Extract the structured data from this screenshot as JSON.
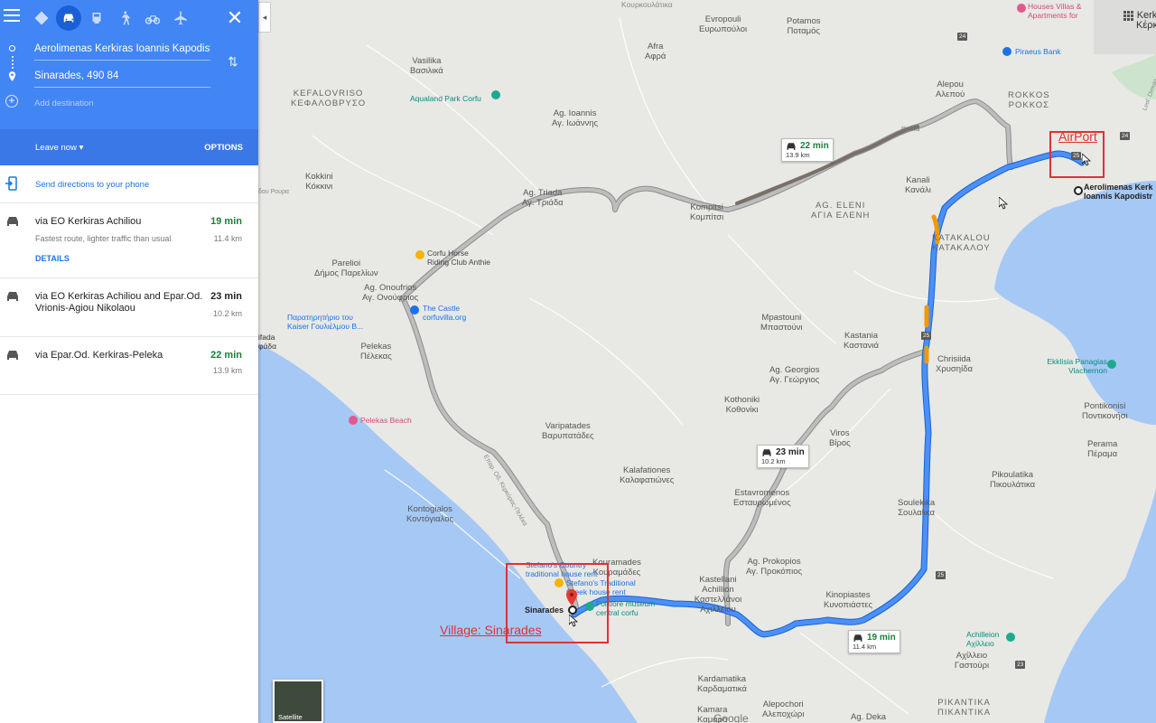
{
  "panel": {
    "travel_modes": [
      "best-mode",
      "driving",
      "transit",
      "walking",
      "cycling",
      "flights"
    ],
    "origin": "Aerolimenas Kerkiras Ioannis Kapodistr",
    "destination": "Sinarades, 490 84",
    "add_destination": "Add destination",
    "leave_now": "Leave now",
    "options": "OPTIONS",
    "send_directions": "Send directions to your phone",
    "routes": [
      {
        "name": "via EO Kerkiras Achiliou",
        "time": "19 min",
        "distance": "11.4 km",
        "subtitle": "Fastest route, lighter traffic than usual",
        "details": "DETAILS"
      },
      {
        "name": "via EO Kerkiras Achiliou and Epar.Od. Vrionis-Agiou Nikolaou",
        "time": "23 min",
        "distance": "10.2 km"
      },
      {
        "name": "via Epar.Od. Kerkiras-Peleka",
        "time": "22 min",
        "distance": "13.9 km"
      }
    ]
  },
  "colors": {
    "primary": "#4285f4",
    "route": "#1a73e8",
    "alt_route": "#9e9e9e",
    "traffic": "#f29900",
    "fast": "#188038",
    "annotation": "#dd3333"
  },
  "map": {
    "places": [
      {
        "latin": "Evropouli",
        "greek": "Ευρωπούλοι"
      },
      {
        "latin": "Potamos",
        "greek": "Ποταμός"
      },
      {
        "latin": "Afra",
        "greek": "Αφρά"
      },
      {
        "latin": "Vasilika",
        "greek": "Βασιλικά"
      },
      {
        "latin": "KEFALOVRISO",
        "greek": "ΚΕΦΑΛΟΒΡΥΣΟ"
      },
      {
        "latin": "Alepou",
        "greek": "Αλεπού"
      },
      {
        "latin": "ROKKOS",
        "greek": "ΡΟΚΚΟΣ"
      },
      {
        "latin": "Ag. Ioannis",
        "greek": "Αγ. Ιωάννης"
      },
      {
        "latin": "Kokkini",
        "greek": "Κόκκινι"
      },
      {
        "latin": "Ag. Triada",
        "greek": "Αγ. Τριάδα"
      },
      {
        "latin": "Kompitsi",
        "greek": "Κομπίτσι"
      },
      {
        "latin": "AG. ELENI",
        "greek": "ΑΓΙΑ ΕΛΕΝΗ"
      },
      {
        "latin": "Kanali",
        "greek": "Κανάλι"
      },
      {
        "latin": "KATAKALOU",
        "greek": "ΚΑΤΑΚΑΛΟΥ"
      },
      {
        "latin": "Pareliοi",
        "greek": "Δήμος Παρελίων"
      },
      {
        "latin": "Ag. Onoufrios",
        "greek": "Αγ. Ονούφριος"
      },
      {
        "latin": "Pelekas",
        "greek": "Πέλεκας"
      },
      {
        "latin": "Mpastouni",
        "greek": "Μπαστούνι"
      },
      {
        "latin": "Kastania",
        "greek": "Καστανιά"
      },
      {
        "latin": "Chrisiida",
        "greek": "Χρυσηίδα"
      },
      {
        "latin": "Ag. Georgios",
        "greek": "Αγ. Γεώργιος"
      },
      {
        "latin": "Kothoniki",
        "greek": "Κοθονίκι"
      },
      {
        "latin": "Viros",
        "greek": "Βίρος"
      },
      {
        "latin": "Pontikonisi",
        "greek": "Ποντικονήσι"
      },
      {
        "latin": "Perama",
        "greek": "Πέραμα"
      },
      {
        "latin": "Varipatades",
        "greek": "Βαρυπατάδες"
      },
      {
        "latin": "Kalafationes",
        "greek": "Καλαφατιώνες"
      },
      {
        "latin": "Estavromenos",
        "greek": "Εσταυρωμένος"
      },
      {
        "latin": "Pikoulatika",
        "greek": "Πικουλάτικα"
      },
      {
        "latin": "Kontogialos",
        "greek": "Κοντόγιαλος"
      },
      {
        "latin": "Soulekika",
        "greek": "Σουλαίικα"
      },
      {
        "latin": "Kouramades",
        "greek": "Κουραμάδες"
      },
      {
        "latin": "Ag. Prokopios",
        "greek": "Αγ. Προκόπιος"
      },
      {
        "latin": "Kastellani Achillion",
        "greek": "Καστελλάνοι Αχιλλείου"
      },
      {
        "latin": "Kinopiastes",
        "greek": "Κυνοπιάστες"
      },
      {
        "latin": "Achilleio",
        "greek": "Αχίλλειο Γαστούρι"
      },
      {
        "latin": "Kardamatika",
        "greek": "Καρδαματικά"
      },
      {
        "latin": "Kamara",
        "greek": "Καμάρα"
      },
      {
        "latin": "Alepochori",
        "greek": "Αλεποχώρι"
      },
      {
        "latin": "Ag. Deka",
        "greek": ""
      },
      {
        "latin": "PIKANTIKA",
        "greek": "ΠΙΚΑΝΤΙΚΑ"
      },
      {
        "latin": "Kerk",
        "greek": "Κέρκ"
      }
    ],
    "pois": {
      "aqualand": "Aqualand Park Corfu",
      "riding_1": "Corfu Horse",
      "riding_2": "Riding Club Anthie",
      "kaiser_1": "Παρατηρητήριο του",
      "kaiser_2": "Kaiser Γουλιέλμου Β...",
      "castle_1": "The Castle",
      "castle_2": "corfuvilla.org",
      "pelekas_beach": "Pelekas Beach",
      "piraeus": "Piraeus Bank",
      "houses_1": "Houses Villas &",
      "houses_2": "Apartments for",
      "vlachernon_1": "Ekklisia Panagias",
      "vlachernon_2": "Vlachernon",
      "achilleion_1": "Achilleion",
      "achilleion_2": "Αχίλλειο",
      "stefanos_1": "Stefano's Country",
      "stefanos_2": "traditional house rent",
      "stefanos_3": "Stefano's Traditional",
      "stefanos_4": "Greek house rent",
      "museum_1": "Folklore museum",
      "museum_2": "central corfu",
      "airport_1": "Aerolimenas Kerk",
      "airport_2": "Ioannis Kapodistr",
      "sinarades": "Sinarades",
      "top_cut": "Κουρκουλάτικα",
      "ag": "ΑΓΙΑ",
      "afada": "ifada",
      "afada2": "φάδα",
      "xlef": "Leof. Dimokr"
    },
    "road_labels": {
      "alepou_ro": "Ρούτα",
      "dou": "δου Ρουρα",
      "eo": "Επαρ. Οδ. Κερκύρας-Πελέκα"
    },
    "route_badges": [
      {
        "time": "22 min",
        "distance": "13.9 km"
      },
      {
        "time": "23 min",
        "distance": "10.2 km"
      },
      {
        "time": "19 min",
        "distance": "11.4 km"
      }
    ],
    "shields": [
      "24",
      "25",
      "25",
      "25",
      "23",
      "24"
    ],
    "satellite_label": "Satellite",
    "google_text": "Google",
    "annotations": {
      "airport": "AirPort",
      "village": "Village: Sinarades"
    }
  }
}
